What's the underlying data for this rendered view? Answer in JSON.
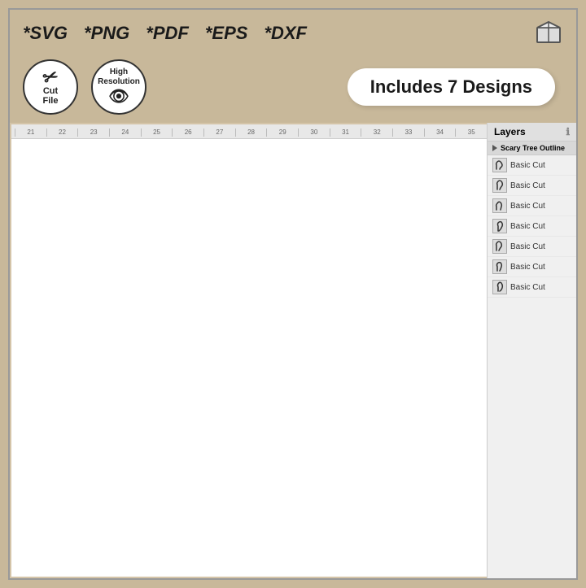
{
  "banner": {
    "formats": [
      "*SVG",
      "*PNG",
      "*PDF",
      "*EPS",
      "*DXF"
    ],
    "includes_label": "Includes 7 Designs"
  },
  "badges": {
    "cut_file_label": "Cut\nFile",
    "high_res_label": "High\nResolution"
  },
  "ruler": {
    "marks": [
      "21",
      "22",
      "23",
      "24",
      "25",
      "26",
      "27",
      "28",
      "29",
      "30",
      "31",
      "32",
      "33",
      "34",
      "35"
    ]
  },
  "layers": {
    "title": "Layers",
    "group_name": "Scary Tree Outline",
    "items": [
      {
        "name": "Basic Cut"
      },
      {
        "name": "Basic Cut"
      },
      {
        "name": "Basic Cut"
      },
      {
        "name": "Basic Cut"
      },
      {
        "name": "Basic Cut"
      },
      {
        "name": "Basic Cut"
      },
      {
        "name": "Basic Cut"
      }
    ]
  }
}
